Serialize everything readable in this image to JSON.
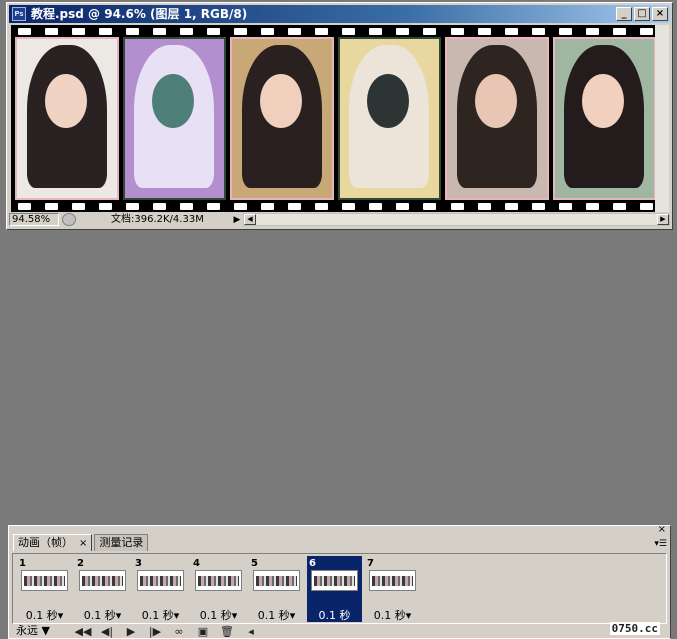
{
  "document": {
    "title": "教程.psd @ 94.6% (图层 1, RGB/8)",
    "app_icon": "Ps",
    "buttons": {
      "minimize": "_",
      "maximize": "□",
      "close": "×"
    },
    "status": {
      "zoom": "94.58%",
      "doc_info": "文档:396.2K/4.33M"
    }
  },
  "canvas": {
    "photos": [
      {
        "border": "#e8b4c0",
        "bg": "#ece8e4",
        "hair": "#2a2222",
        "face": "#f1d3c4"
      },
      {
        "border": "#2f4a34",
        "bg": "#b48fd0",
        "hair": "#e8e0f4",
        "face": "#4d7e78"
      },
      {
        "border": "#e8b4c0",
        "bg": "#c9a878",
        "hair": "#2a2020",
        "face": "#f0d0bc"
      },
      {
        "border": "#2f4a34",
        "bg": "#e8d8a0",
        "hair": "#ece4d8",
        "face": "#2c3434"
      },
      {
        "border": "#e8b4c0",
        "bg": "#c8b8b0",
        "hair": "#2e2420",
        "face": "#e9c6b4"
      },
      {
        "border": "#e8b4c0",
        "bg": "#9fb7a0",
        "hair": "#241c1c",
        "face": "#f2d0c0"
      }
    ]
  },
  "animation": {
    "tabs": [
      {
        "label": "动画（帧）",
        "active": true,
        "close": "×"
      },
      {
        "label": "测量记录",
        "active": false
      }
    ],
    "frames": [
      {
        "num": "1",
        "delay": "0.1 秒▾",
        "selected": false
      },
      {
        "num": "2",
        "delay": "0.1 秒▾",
        "selected": false
      },
      {
        "num": "3",
        "delay": "0.1 秒▾",
        "selected": false
      },
      {
        "num": "4",
        "delay": "0.1 秒▾",
        "selected": false
      },
      {
        "num": "5",
        "delay": "0.1 秒▾",
        "selected": false
      },
      {
        "num": "6",
        "delay": "0.1 秒",
        "selected": true
      },
      {
        "num": "7",
        "delay": "0.1 秒▾",
        "selected": false
      }
    ],
    "loop": "永远",
    "controls": [
      "◀◀",
      "◀|",
      "▶",
      "|▶"
    ],
    "watermark": "0750.cc"
  },
  "colors": {
    "selection": "#0a246a",
    "titlebar": "#0a246a"
  }
}
